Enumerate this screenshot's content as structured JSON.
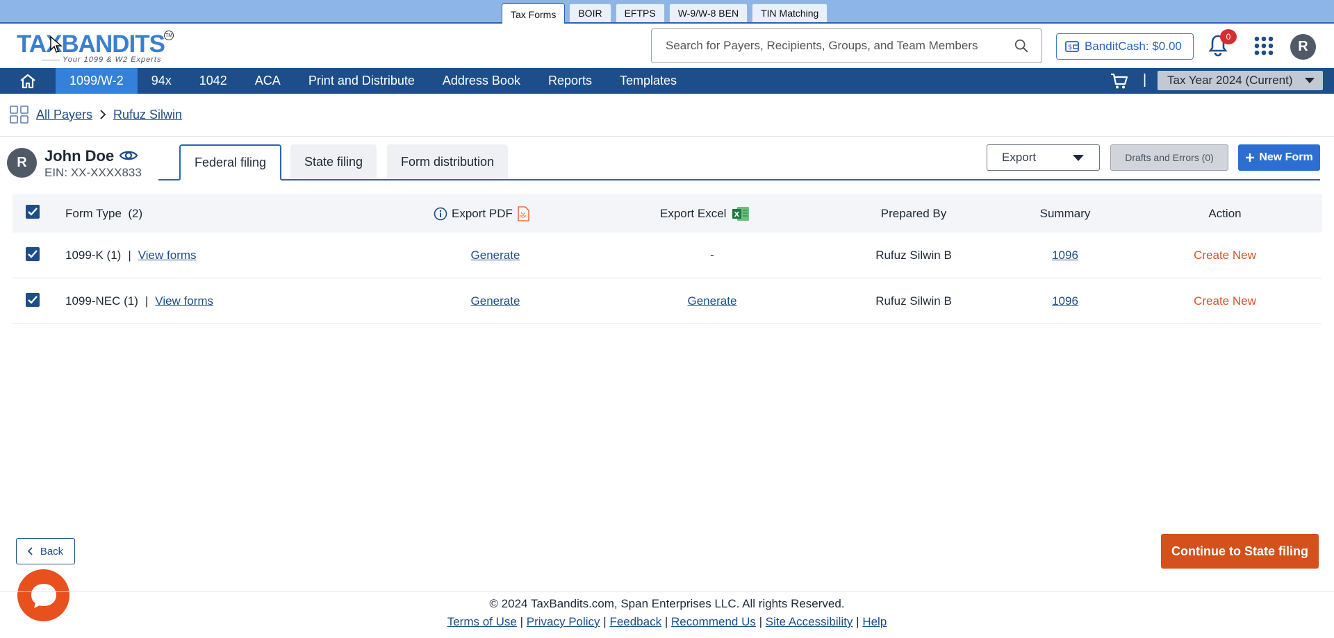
{
  "product_tabs": [
    "Tax Forms",
    "BOIR",
    "EFTPS",
    "W-9/W-8 BEN",
    "TIN Matching"
  ],
  "logo": {
    "part1": "TAX",
    "part2": "BANDITS",
    "tagline": "Your 1099 & W2 Experts",
    "tm": "TM"
  },
  "search": {
    "placeholder": "Search for Payers, Recipients, Groups, and Team Members"
  },
  "bandit_cash": "BanditCash: $0.00",
  "notifications": {
    "count": "0"
  },
  "user": {
    "initial": "R"
  },
  "nav": {
    "items": [
      "1099/W-2",
      "94x",
      "1042",
      "ACA",
      "Print and Distribute",
      "Address Book",
      "Reports",
      "Templates"
    ],
    "active": "1099/W-2",
    "separator": "|",
    "tax_year": "Tax Year 2024 (Current)"
  },
  "breadcrumb": {
    "all_payers": "All Payers",
    "current": "Rufuz Silwin"
  },
  "payer": {
    "initial": "R",
    "name": "John Doe",
    "ein": "EIN: XX-XXXX833"
  },
  "filing_tabs": [
    "Federal filing",
    "State filing",
    "Form distribution"
  ],
  "actions": {
    "export": "Export",
    "drafts": "Drafts and Errors (0)",
    "new_form": "New Form"
  },
  "table": {
    "headers": {
      "form_type": "Form Type",
      "form_count": "(2)",
      "export_pdf": "Export PDF",
      "export_excel": "Export Excel",
      "prepared_by": "Prepared By",
      "summary": "Summary",
      "action": "Action"
    },
    "rows": [
      {
        "form": "1099-K (1)",
        "sep": "|",
        "view": "View forms",
        "pdf": "Generate",
        "excel": "-",
        "prepared_by": "Rufuz Silwin B",
        "summary": "1096",
        "action": "Create New"
      },
      {
        "form": "1099-NEC (1)",
        "sep": "|",
        "view": "View forms",
        "pdf": "Generate",
        "excel": "Generate",
        "prepared_by": "Rufuz Silwin B",
        "summary": "1096",
        "action": "Create New"
      }
    ]
  },
  "buttons": {
    "back": "Back",
    "continue": "Continue to State filing"
  },
  "footer": {
    "copyright": "© 2024 TaxBandits.com, Span Enterprises LLC. All rights Reserved.",
    "links": [
      "Terms of Use",
      "Privacy Policy",
      "Feedback",
      "Recommend Us",
      "Site Accessibility",
      "Help"
    ],
    "link_sep": "|"
  },
  "colors": {
    "nav_bg": "#1d4e89",
    "nav_active": "#3580d8",
    "accent": "#2d6fd1",
    "cta": "#d4501c",
    "create_new": "#d9531e"
  }
}
